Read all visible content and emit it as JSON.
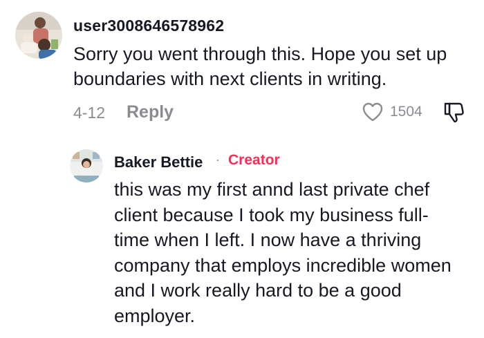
{
  "comment": {
    "username": "user3008646578962",
    "avatar_icon": "user-avatar-photo",
    "text": "Sorry you went through this. Hope you set up boundaries with next clients in writing.",
    "date": "4-12",
    "reply_label": "Reply",
    "like_count": "1504",
    "like_icon": "heart-outline-icon",
    "dislike_icon": "thumbs-down-icon"
  },
  "reply": {
    "author": "Baker Bettie",
    "separator": "·",
    "badge": "Creator",
    "badge_color": "#fe2c55",
    "avatar_icon": "creator-avatar-photo",
    "text": "this was my first annd last private chef client because I took my business full-time when I left.  I now have a thriving company that employs incredible women and I work really hard to be a good employer."
  },
  "colors": {
    "text": "#161823",
    "muted": "#8a8b91",
    "accent": "#fe2c55"
  }
}
